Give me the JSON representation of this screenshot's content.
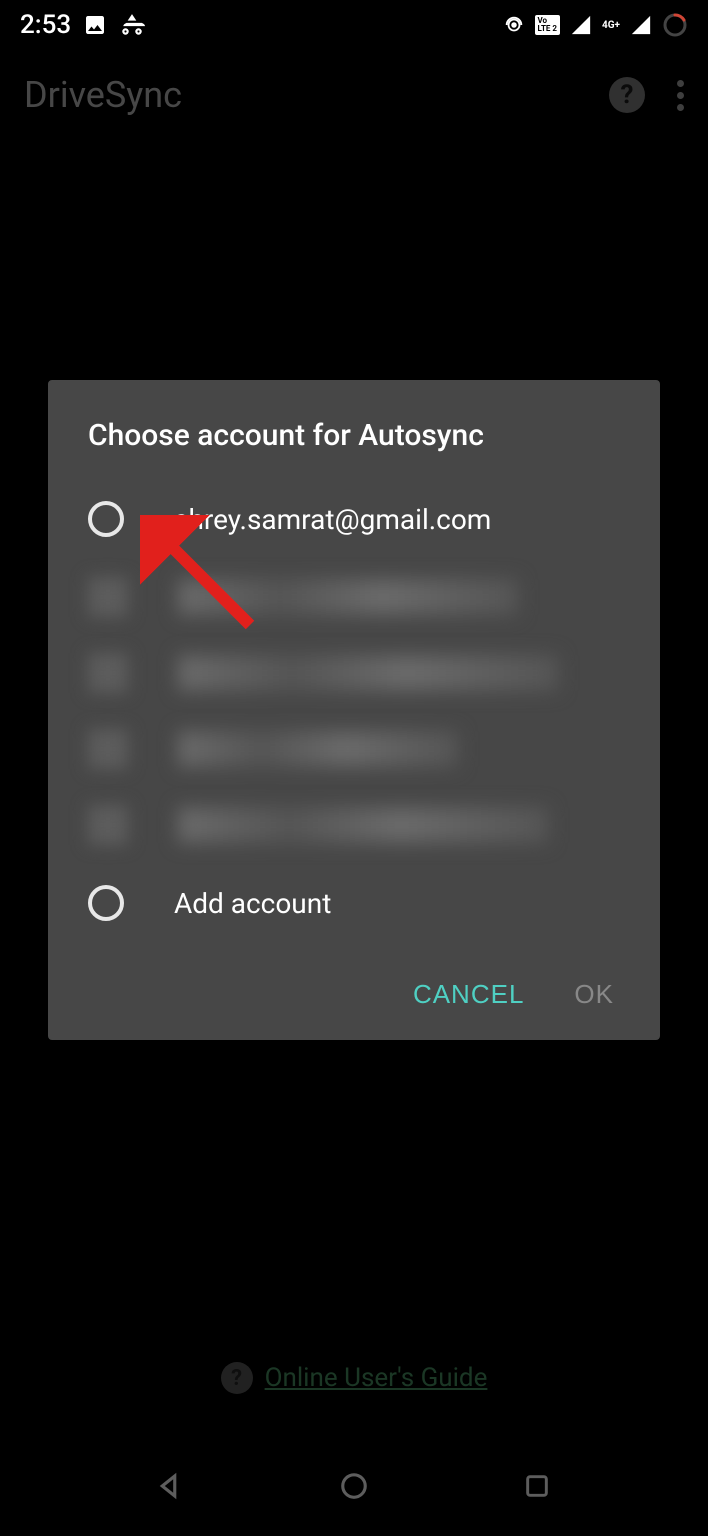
{
  "statusBar": {
    "time": "2:53",
    "lteLabel": "LTE",
    "networkLabel": "4G+"
  },
  "appBar": {
    "title": "DriveSync"
  },
  "dialog": {
    "title": "Choose account for Autosync",
    "accounts": [
      {
        "email": "shrey.samrat@gmail.com",
        "visible": true
      },
      {
        "email": "",
        "visible": false
      },
      {
        "email": "",
        "visible": false
      },
      {
        "email": "",
        "visible": false
      },
      {
        "email": "",
        "visible": false
      }
    ],
    "addAccountLabel": "Add account",
    "cancelLabel": "CANCEL",
    "okLabel": "OK"
  },
  "footer": {
    "linkText": "Online User's Guide"
  }
}
